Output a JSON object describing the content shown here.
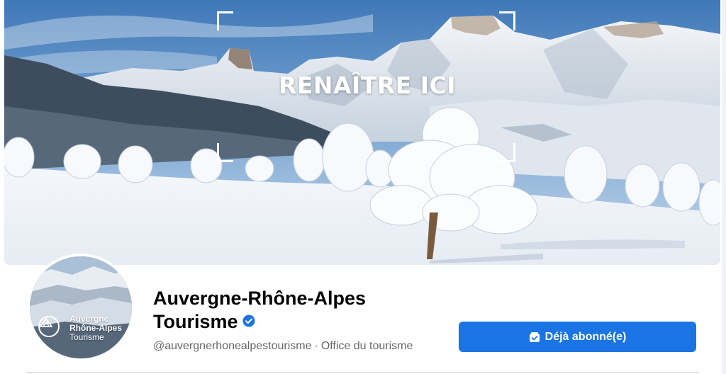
{
  "cover": {
    "headline": "RENAÎTRE ICI",
    "image": "snowy-alpine-mountains-with-frosted-trees"
  },
  "avatar": {
    "line1": "Auvergne",
    "line2": "Rhône-Alpes",
    "line3": "Tourisme",
    "logo_icon": "mountain-logo-icon"
  },
  "profile": {
    "name": "Auvergne-Rhône-Alpes Tourisme",
    "verified_icon": "verified-badge-icon",
    "handle": "@auvergnerhonealpestourisme",
    "separator": "·",
    "category": "Office du tourisme"
  },
  "actions": {
    "follow_label": "Déjà abonné(e)",
    "follow_icon": "subscribed-icon"
  },
  "colors": {
    "button": "#1b74e4",
    "verified": "#1b74e4",
    "secondary_text": "#65676b",
    "primary_text": "#050505"
  }
}
